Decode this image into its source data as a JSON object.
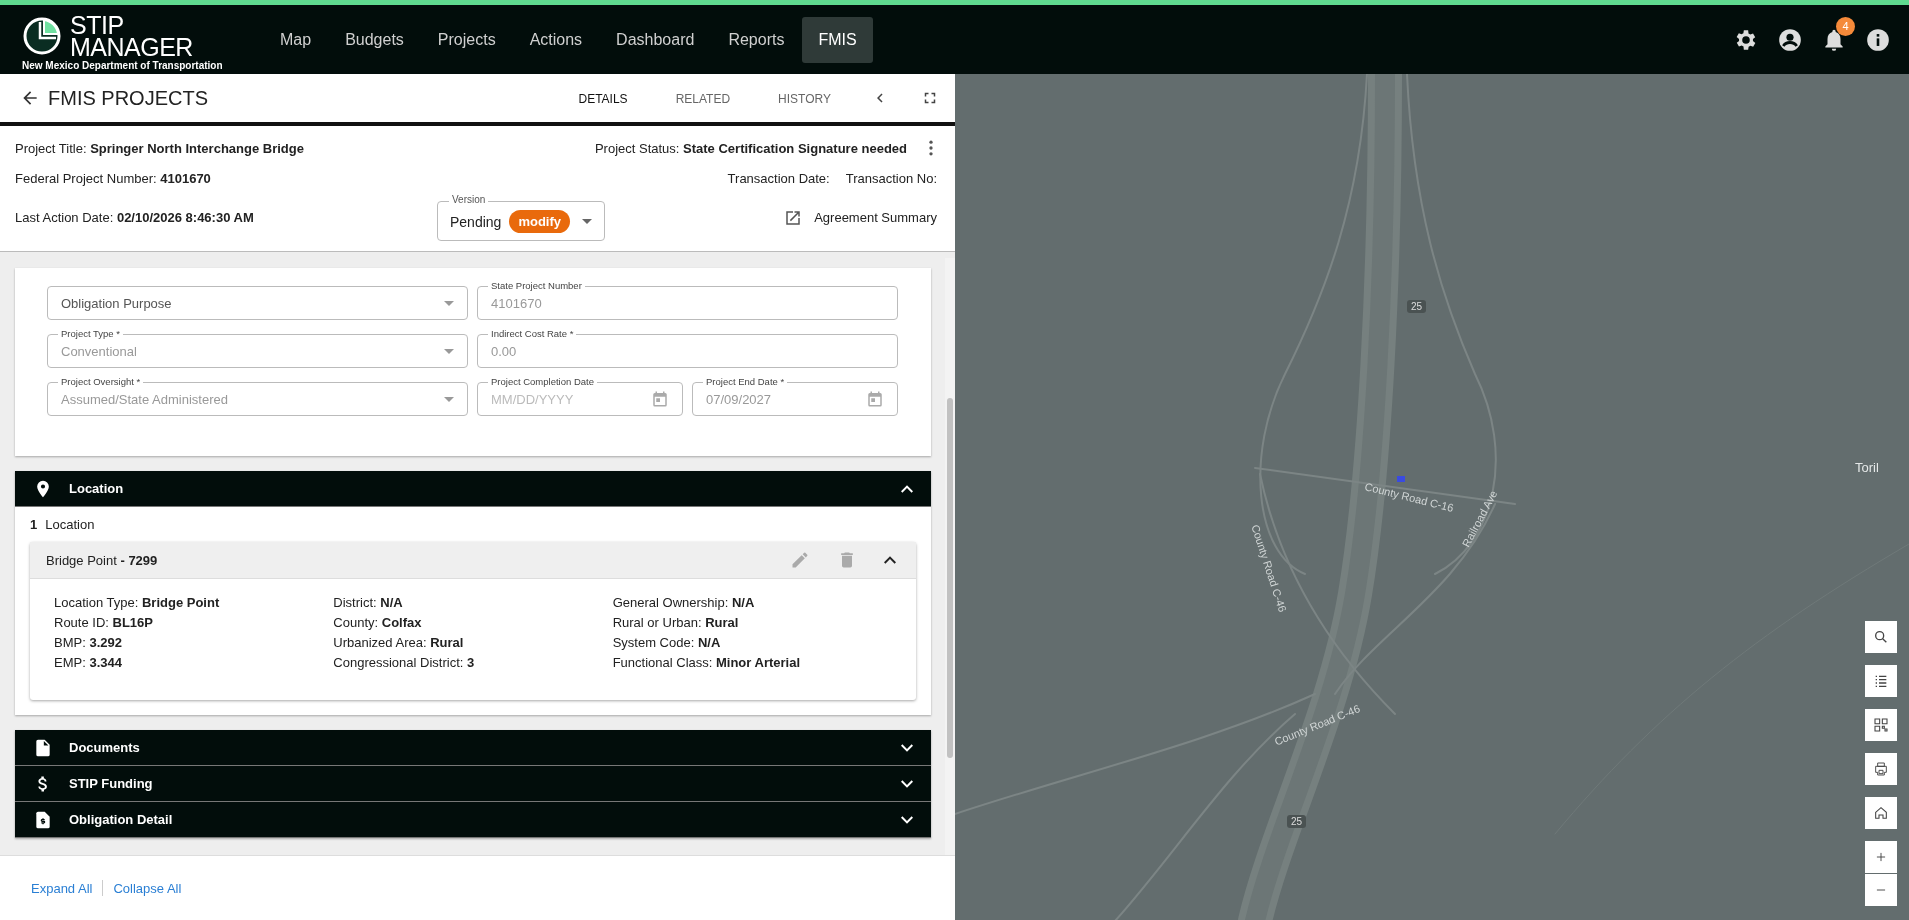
{
  "header": {
    "logo_line1": "STIP",
    "logo_line2": "MANAGER",
    "logo_subtitle": "New Mexico Department of Transportation",
    "nav": [
      {
        "label": "Map",
        "selected": false
      },
      {
        "label": "Budgets",
        "selected": false
      },
      {
        "label": "Projects",
        "selected": false
      },
      {
        "label": "Actions",
        "selected": false
      },
      {
        "label": "Dashboard",
        "selected": false
      },
      {
        "label": "Reports",
        "selected": false
      },
      {
        "label": "FMIS",
        "selected": true
      }
    ],
    "notification_count": "4"
  },
  "panel": {
    "title": "FMIS PROJECTS",
    "tabs": [
      {
        "label": "DETAILS",
        "selected": true
      },
      {
        "label": "RELATED",
        "selected": false
      },
      {
        "label": "HISTORY",
        "selected": false
      }
    ]
  },
  "project": {
    "title_label": "Project Title:",
    "title": "Springer North Interchange Bridge",
    "status_label": "Project Status:",
    "status": "State Certification Signature needed",
    "federal_label": "Federal Project Number:",
    "federal": "4101670",
    "transaction_date_label": "Transaction Date:",
    "transaction_no_label": "Transaction No:",
    "last_action_label": "Last Action Date:",
    "last_action": "02/10/2026 8:46:30 AM",
    "version": {
      "label": "Version",
      "value": "Pending",
      "badge": "modify"
    },
    "agreement_link": "Agreement Summary"
  },
  "form_rows": [
    [
      {
        "kind": "select",
        "placeholder": "Obligation Purpose"
      },
      {
        "kind": "text",
        "label": "State Project Number",
        "value": "4101670"
      }
    ],
    [
      {
        "kind": "select",
        "label": "Project Type *",
        "value": "Conventional"
      },
      {
        "kind": "text",
        "label": "Indirect Cost Rate *",
        "value": "0.00"
      }
    ],
    [
      {
        "kind": "select",
        "label": "Project Oversight *",
        "value": "Assumed/State Administered"
      },
      {
        "kind": "date",
        "label": "Project Completion Date",
        "placeholder": "MM/DD/YYYY"
      },
      {
        "kind": "date",
        "label": "Project End Date *",
        "value": "07/09/2027"
      }
    ]
  ],
  "location": {
    "title": "Location",
    "expanded": true,
    "count": "1",
    "count_label": "Location",
    "item": {
      "name": "Bridge Point",
      "id": "- 7299",
      "expanded": true,
      "columns": [
        [
          {
            "label": "Location Type:",
            "value": "Bridge Point"
          },
          {
            "label": "Route ID:",
            "value": "BL16P"
          },
          {
            "label": "BMP:",
            "value": "3.292"
          },
          {
            "label": "EMP:",
            "value": "3.344"
          }
        ],
        [
          {
            "label": "District:",
            "value": "N/A"
          },
          {
            "label": "County:",
            "value": "Colfax"
          },
          {
            "label": "Urbanized Area:",
            "value": "Rural"
          },
          {
            "label": "Congressional District:",
            "value": "3"
          }
        ],
        [
          {
            "label": "General Ownership:",
            "value": "N/A"
          },
          {
            "label": "Rural or Urban:",
            "value": "Rural"
          },
          {
            "label": "System Code:",
            "value": "N/A"
          },
          {
            "label": "Functional Class:",
            "value": "Minor Arterial"
          }
        ]
      ]
    }
  },
  "sections": [
    {
      "kind": "document",
      "title": "Documents",
      "expanded": false
    },
    {
      "kind": "dollar",
      "title": "STIP Funding",
      "expanded": false
    },
    {
      "kind": "receipt",
      "title": "Obligation Detail",
      "expanded": false
    }
  ],
  "footer_links": [
    "Expand All",
    "Collapse All"
  ],
  "map": {
    "labels": [
      {
        "kind": "place",
        "text": "Toril"
      },
      {
        "kind": "road",
        "text": "County Road C-16"
      },
      {
        "kind": "road",
        "text": "County Road C-46"
      },
      {
        "kind": "road",
        "text": "Railroad Ave"
      },
      {
        "kind": "road",
        "text": "County Road C-46"
      },
      {
        "kind": "shield",
        "text": "25"
      },
      {
        "kind": "shield",
        "text": "25"
      }
    ]
  }
}
